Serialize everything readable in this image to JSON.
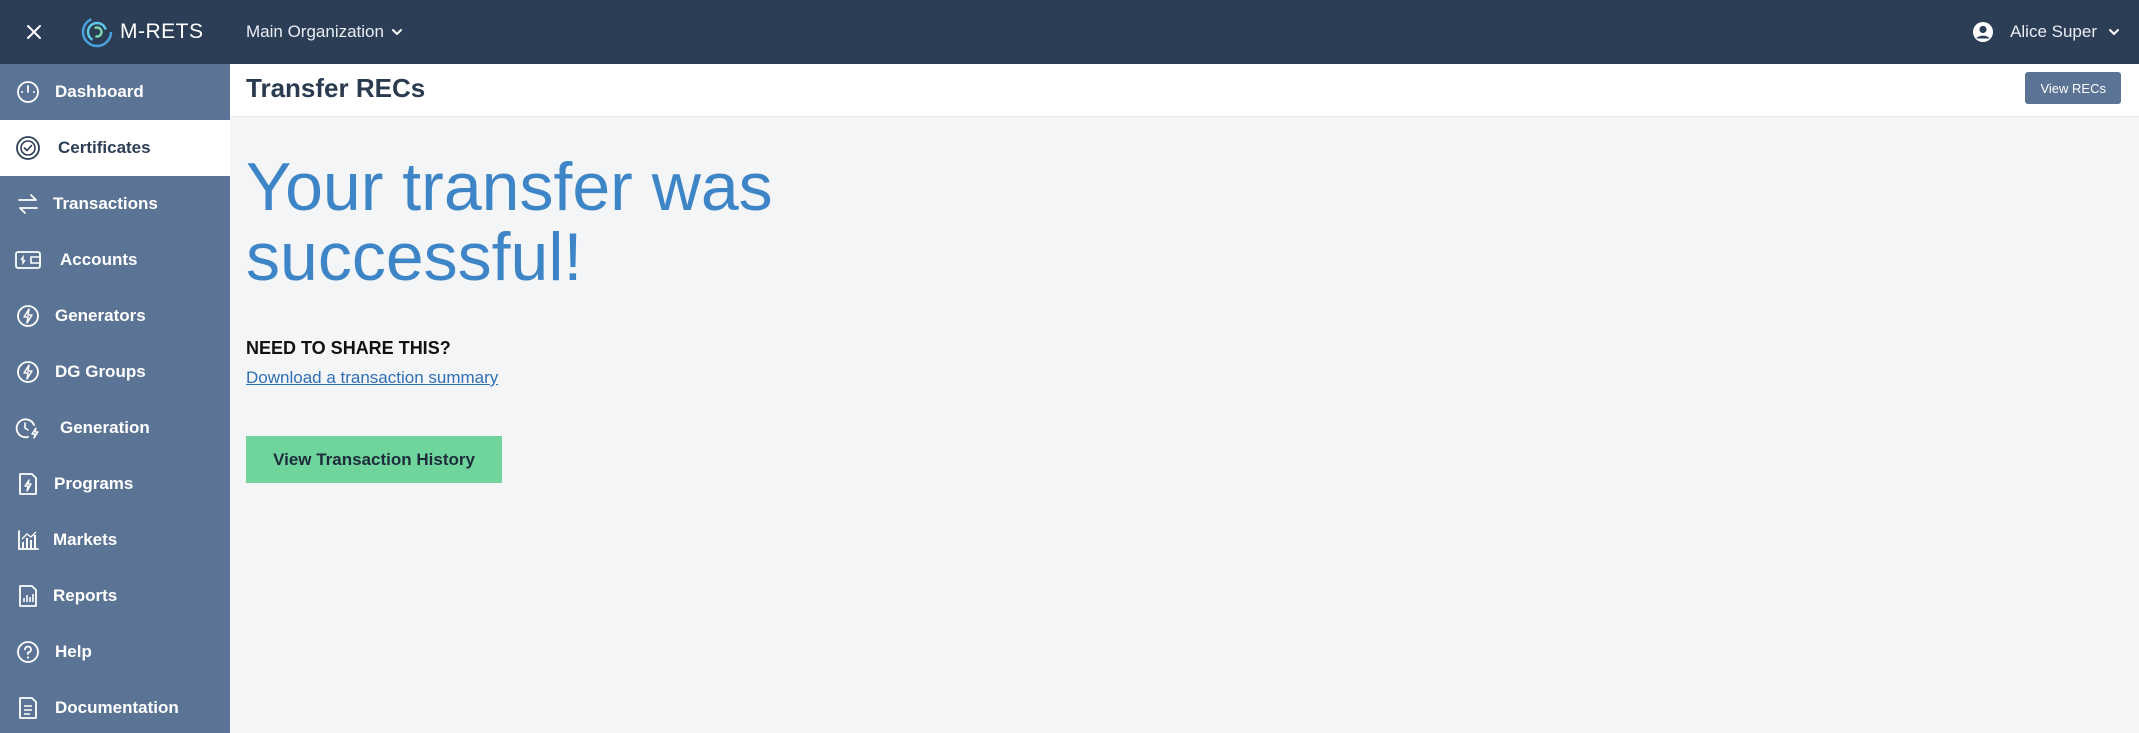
{
  "app": {
    "brand": "M-RETS",
    "organization": "Main Organization",
    "user_name": "Alice Super"
  },
  "sidebar": {
    "items": [
      {
        "label": "Dashboard",
        "icon": "dashboard-gauge-icon",
        "active": false
      },
      {
        "label": "Certificates",
        "icon": "certificate-seal-icon",
        "active": true
      },
      {
        "label": "Transactions",
        "icon": "transfer-arrows-icon",
        "active": false
      },
      {
        "label": "Accounts",
        "icon": "wallet-icon",
        "active": false
      },
      {
        "label": "Generators",
        "icon": "bolt-circle-icon",
        "active": false
      },
      {
        "label": "DG Groups",
        "icon": "bolt-circle-icon",
        "active": false
      },
      {
        "label": "Generation",
        "icon": "clock-bolt-icon",
        "active": false
      },
      {
        "label": "Programs",
        "icon": "document-bolt-icon",
        "active": false
      },
      {
        "label": "Markets",
        "icon": "bar-chart-icon",
        "active": false
      },
      {
        "label": "Reports",
        "icon": "report-chart-icon",
        "active": false
      },
      {
        "label": "Help",
        "icon": "question-circle-icon",
        "active": false
      },
      {
        "label": "Documentation",
        "icon": "document-lines-icon",
        "active": false
      }
    ]
  },
  "header": {
    "title": "Transfer RECs",
    "view_recs_label": "View RECs"
  },
  "main": {
    "success_message": "Your transfer was successful!",
    "share_heading": "NEED TO SHARE THIS?",
    "download_link": "Download a transaction summary",
    "history_button": "View Transaction History"
  },
  "colors": {
    "topbar": "#2c3e56",
    "sidebar": "#5b7394",
    "accent_blue": "#3d85c6",
    "success_green": "#6fd59c"
  }
}
